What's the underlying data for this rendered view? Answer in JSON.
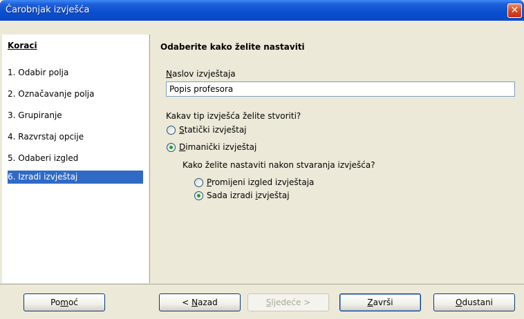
{
  "window": {
    "title": "Čarobnjak izvješća",
    "close_glyph": "✕"
  },
  "sidebar": {
    "title": "Koraci",
    "steps": [
      {
        "label": "1.  Odabir polja"
      },
      {
        "label": "2.  Označavanje polja"
      },
      {
        "label": "3.  Grupiranje"
      },
      {
        "label": "4.  Razvrstaj opcije"
      },
      {
        "label": "5.  Odaberi izgled"
      },
      {
        "label": "6.  Izradi izvještaj",
        "active": true
      }
    ]
  },
  "content": {
    "title": "Odaberite kako želite nastaviti",
    "report_title_label_first": "N",
    "report_title_label_rest": "aslov izvještaja",
    "report_title_value": "Popis profesora",
    "report_type_question": "Kakav tip izvješća želite stvoriti?",
    "static_option_first": "S",
    "static_option_rest": "tatički izvještaj",
    "dynamic_option_first": "D",
    "dynamic_option_rest": "imanički izvještaj",
    "continue_question": "Kako želite nastaviti nakon stvaranja izvješća?",
    "modify_option_first": "P",
    "modify_option_rest": "romijeni izgled izvještaja",
    "create_option_pre": "Sada izradi ",
    "create_option_u": "i",
    "create_option_post": "zvještaj"
  },
  "buttons": {
    "help_pre": "Po",
    "help_u": "m",
    "help_post": "oć",
    "back_pre": "< ",
    "back_u": "N",
    "back_post": "azad",
    "next_u": "S",
    "next_post": "ljedeće >",
    "finish_u": "Z",
    "finish_post": "avrši",
    "cancel_u": "O",
    "cancel_post": "dustani"
  },
  "colors": {
    "accent": "#316ac5",
    "title_bar": "#0a4fd0",
    "radio_dot": "#21a121"
  },
  "selected": {
    "report_type": "dynamic",
    "after_create": "create_now"
  }
}
